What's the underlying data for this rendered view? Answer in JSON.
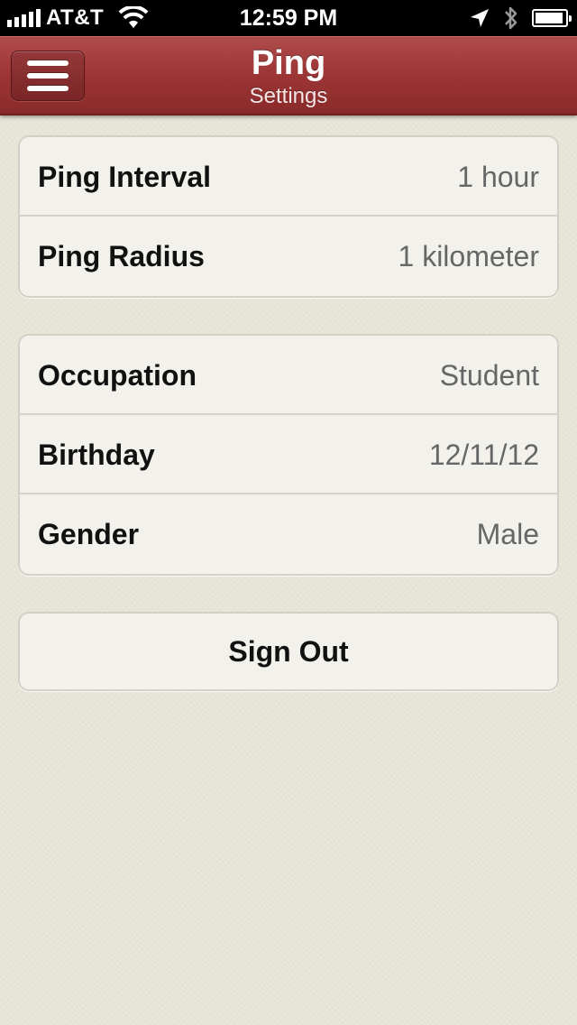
{
  "status_bar": {
    "carrier": "AT&T",
    "time": "12:59 PM",
    "signal_bars": 5,
    "battery_level": 0.95
  },
  "nav": {
    "title": "Ping",
    "subtitle": "Settings",
    "menu_icon": "hamburger-menu-icon",
    "accent_color": "#9c3535"
  },
  "groups": [
    {
      "rows": [
        {
          "label": "Ping Interval",
          "value": "1 hour"
        },
        {
          "label": "Ping Radius",
          "value": "1 kilometer"
        }
      ]
    },
    {
      "rows": [
        {
          "label": "Occupation",
          "value": "Student"
        },
        {
          "label": "Birthday",
          "value": "12/11/12"
        },
        {
          "label": "Gender",
          "value": "Male"
        }
      ]
    }
  ],
  "actions": {
    "sign_out_label": "Sign Out"
  }
}
